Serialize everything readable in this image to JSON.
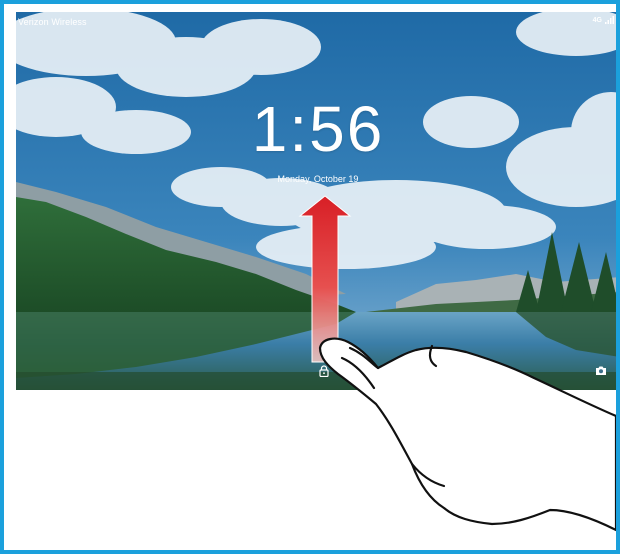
{
  "status_bar": {
    "carrier": "Verizon Wireless",
    "network_type": "4G",
    "signal_icon": "signal-bars-icon"
  },
  "lockscreen": {
    "time": "1:56",
    "date": "Monday, October 19",
    "left_icon": "lock-icon",
    "right_icon": "camera-icon"
  },
  "gesture": {
    "direction": "swipe-up",
    "arrow_color": "#e02828",
    "hand_icon": "hand-swipe-icon"
  },
  "colors": {
    "frame_border": "#1ba0dc",
    "sky": "#2f77ae",
    "lake": "#3a86b4"
  }
}
